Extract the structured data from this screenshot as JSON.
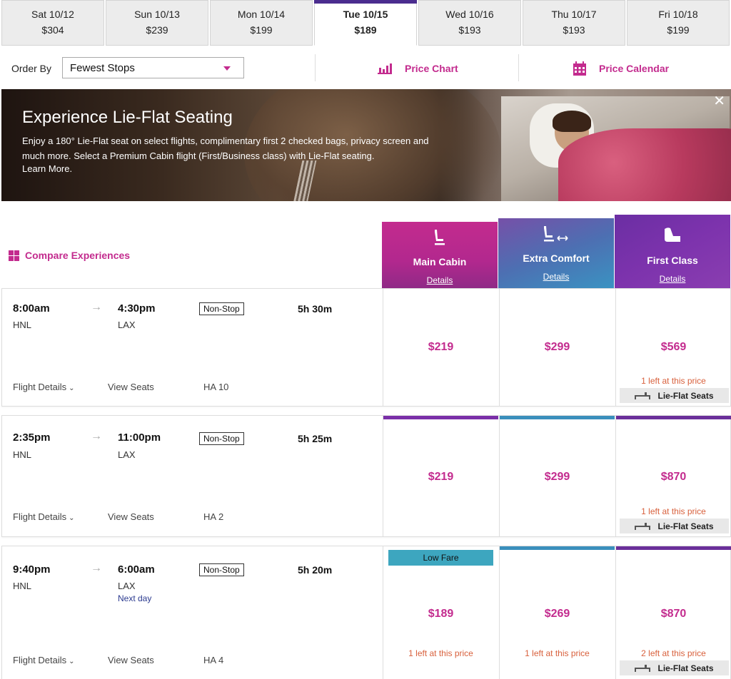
{
  "date_tabs": [
    {
      "date": "Sat 10/12",
      "price": "$304"
    },
    {
      "date": "Sun 10/13",
      "price": "$239"
    },
    {
      "date": "Mon 10/14",
      "price": "$199"
    },
    {
      "date": "Tue 10/15",
      "price": "$189",
      "selected": true
    },
    {
      "date": "Wed 10/16",
      "price": "$193"
    },
    {
      "date": "Thu 10/17",
      "price": "$193"
    },
    {
      "date": "Fri 10/18",
      "price": "$199"
    }
  ],
  "toolbar": {
    "order_label": "Order By",
    "order_value": "Fewest Stops",
    "price_chart": "Price Chart",
    "price_calendar": "Price Calendar"
  },
  "banner": {
    "title": "Experience Lie-Flat Seating",
    "body": "Enjoy a 180° Lie-Flat seat on select flights, complimentary first 2 checked bags, privacy screen and much more. Select a Premium Cabin flight (First/Business class) with Lie-Flat seating.",
    "learn_more": "Learn More.",
    "close": "✕"
  },
  "compare_label": "Compare Experiences",
  "cabins": [
    {
      "name": "Main Cabin",
      "details": "Details",
      "color": "#c32b8e"
    },
    {
      "name": "Extra Comfort",
      "details": "Details",
      "color": "#3d8fbf"
    },
    {
      "name": "First Class",
      "details": "Details",
      "color": "#7a2fa8"
    }
  ],
  "colors": {
    "accent": "#c32b8e",
    "navy": "#4b2d8f",
    "main_bar": "#7a2fa8",
    "extra_bar": "#3a8fbc",
    "first_bar": "#6a2f9a",
    "low_fare": "#3da6bf"
  },
  "flights": [
    {
      "depart": "8:00am",
      "from": "HNL",
      "arrive": "4:30pm",
      "to": "LAX",
      "next_day": "",
      "stops": "Non-Stop",
      "duration": "5h 30m",
      "flight_details": "Flight Details",
      "view_seats": "View Seats",
      "flight_no": "HA 10",
      "fares": [
        {
          "price": "$219",
          "left": "",
          "lie_flat": ""
        },
        {
          "price": "$299",
          "left": "",
          "lie_flat": ""
        },
        {
          "price": "$569",
          "left": "1 left at this price",
          "lie_flat": "Lie-Flat Seats"
        }
      ]
    },
    {
      "depart": "2:35pm",
      "from": "HNL",
      "arrive": "11:00pm",
      "to": "LAX",
      "next_day": "",
      "stops": "Non-Stop",
      "duration": "5h 25m",
      "flight_details": "Flight Details",
      "view_seats": "View Seats",
      "flight_no": "HA 2",
      "fares": [
        {
          "price": "$219",
          "left": "",
          "lie_flat": ""
        },
        {
          "price": "$299",
          "left": "",
          "lie_flat": ""
        },
        {
          "price": "$870",
          "left": "1 left at this price",
          "lie_flat": "Lie-Flat Seats"
        }
      ]
    },
    {
      "depart": "9:40pm",
      "from": "HNL",
      "arrive": "6:00am",
      "to": "LAX",
      "next_day": "Next day",
      "stops": "Non-Stop",
      "duration": "5h 20m",
      "flight_details": "Flight Details",
      "view_seats": "View Seats",
      "flight_no": "HA 4",
      "low_fare": "Low Fare",
      "fares": [
        {
          "price": "$189",
          "left": "1 left at this price",
          "lie_flat": ""
        },
        {
          "price": "$269",
          "left": "1 left at this price",
          "lie_flat": ""
        },
        {
          "price": "$870",
          "left": "2 left at this price",
          "lie_flat": "Lie-Flat Seats"
        }
      ]
    }
  ]
}
